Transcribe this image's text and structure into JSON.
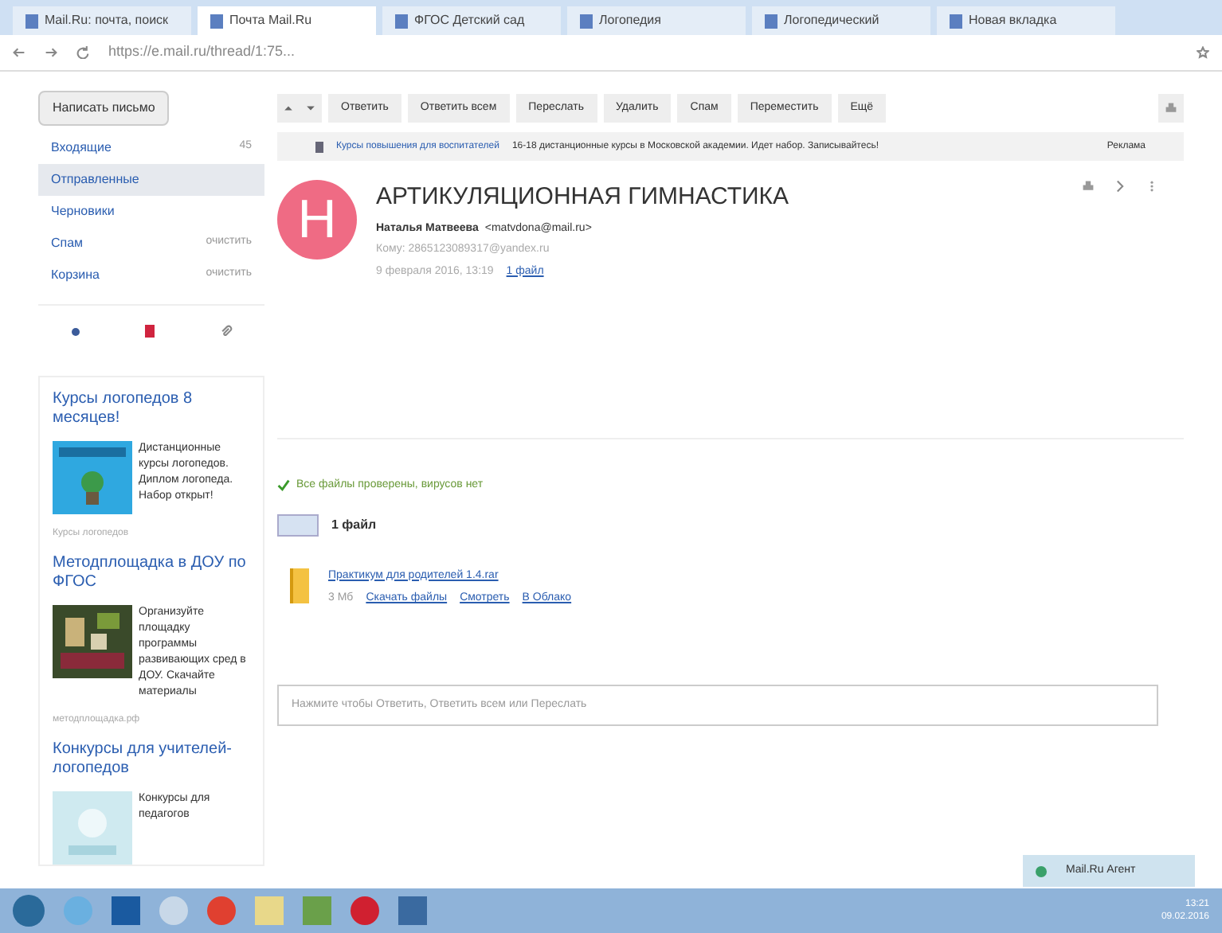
{
  "browser": {
    "tabs": [
      {
        "label": "Mail.Ru: почта, поиск",
        "selected": false
      },
      {
        "label": "Почта Mail.Ru",
        "selected": true
      },
      {
        "label": "ФГОС Детский сад",
        "selected": false
      },
      {
        "label": "Логопедия",
        "selected": false
      },
      {
        "label": "Логопедический",
        "selected": false
      },
      {
        "label": "Новая вкладка",
        "selected": false
      }
    ],
    "url": "https://e.mail.ru/thread/1:75..."
  },
  "sidebar": {
    "compose": "Написать письмо",
    "folders": [
      {
        "label": "Входящие",
        "count": "45",
        "selected": false
      },
      {
        "label": "Отправленные",
        "selected": true
      },
      {
        "label": "Черновики",
        "selected": false
      },
      {
        "label": "Спам",
        "count": "очистить",
        "selected": false
      },
      {
        "label": "Корзина",
        "count": "очистить",
        "selected": false
      }
    ],
    "ads": [
      {
        "title": "Курсы логопедов 8 месяцев!",
        "text": "Дистанционные курсы логопедов. Диплом логопеда. Набор открыт!",
        "footer": "Курсы логопедов"
      },
      {
        "title": "Методплощадка в ДОУ по ФГОС",
        "text": "Организуйте площадку программы развивающих сред в ДОУ. Скачайте материалы",
        "footer": "методплощадка.рф"
      },
      {
        "title": "Конкурсы для учителей-логопедов",
        "text": "Конкурсы для педагогов"
      }
    ]
  },
  "toolbar": {
    "actions": [
      "Ответить",
      "Ответить всем",
      "Переслать",
      "Удалить",
      "Спам",
      "Переместить",
      "Ещё"
    ]
  },
  "banner": {
    "link": "Курсы повышения для воспитателей",
    "text": "16-18 дистанционные курсы в Московской академии. Идет набор. Записывайтесь!",
    "action": "Реклама"
  },
  "message": {
    "avatar": "Н",
    "subject": "АРТИКУЛЯЦИОННАЯ ГИМНАСТИКА",
    "from": "Наталья Матвеева",
    "from_email": "<matvdona@mail.ru>",
    "to": "Кому: 2865123089317@yandex.ru",
    "date": "9 февраля 2016, 13:19",
    "files_link": "1 файл",
    "scan": "Все файлы проверены, вирусов нет",
    "files_count": "1 файл",
    "attachment": {
      "name": "Практикум для родителей 1.4.rar",
      "size": "3 Мб",
      "actions": [
        "Скачать файлы",
        "Смотреть",
        "В Облако"
      ]
    },
    "reply_placeholder": "Нажмите чтобы Ответить, Ответить всем или Переслать"
  },
  "notification": "Mail.Ru Агент",
  "clock": {
    "time": "13:21",
    "date": "09.02.2016"
  }
}
